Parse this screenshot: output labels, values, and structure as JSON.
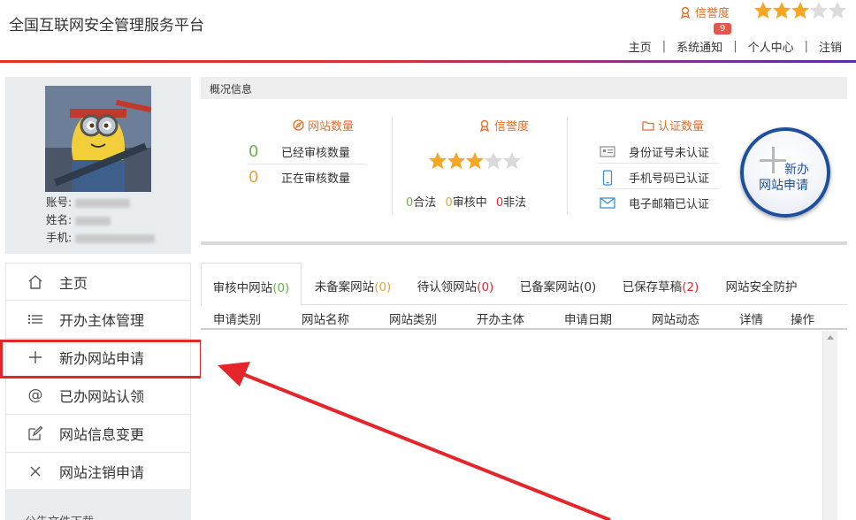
{
  "header": {
    "title": "全国互联网安全管理服务平台",
    "credit_label": "信誉度",
    "credit_stars": 3,
    "credit_stars_max": 5,
    "nav": [
      "主页",
      "系统通知",
      "个人中心",
      "注销"
    ],
    "notify_count": "9"
  },
  "profile": {
    "account_label": "账号:",
    "name_label": "姓名:",
    "phone_label": "手机:"
  },
  "menu": {
    "items": [
      {
        "label": "主页",
        "icon": "home-icon"
      },
      {
        "label": "开办主体管理",
        "icon": "list-icon"
      },
      {
        "label": "新办网站申请",
        "icon": "plus-icon"
      },
      {
        "label": "已办网站认领",
        "icon": "at-icon"
      },
      {
        "label": "网站信息变更",
        "icon": "edit-icon"
      },
      {
        "label": "网站注销申请",
        "icon": "close-icon"
      }
    ],
    "extra_label": "公告文件下载"
  },
  "overview": {
    "title": "概况信息",
    "site_count_title": "网站数量",
    "reviewed_num": "0",
    "reviewed_label": "已经审核数量",
    "reviewing_num": "0",
    "reviewing_label": "正在审核数量",
    "credit_title": "信誉度",
    "credit_stars": 3,
    "legal_num": "0",
    "legal_label": "合法",
    "auditing_num": "0",
    "auditing_label": "审核中",
    "illegal_num": "0",
    "illegal_label": "非法",
    "cert_title": "认证数量",
    "cert_items": [
      {
        "label": "身份证号未认证",
        "icon": "id-card-icon"
      },
      {
        "label": "手机号码已认证",
        "icon": "phone-icon"
      },
      {
        "label": "电子邮箱已认证",
        "icon": "mail-icon"
      }
    ],
    "new_site_line1": "新办",
    "new_site_line2": "网站申请"
  },
  "tabs": [
    {
      "label": "审核中网站",
      "count": "(0)"
    },
    {
      "label": "未备案网站",
      "count": "(0)"
    },
    {
      "label": "待认领网站",
      "count": "(0)"
    },
    {
      "label": "已备案网站",
      "count": "(0)"
    },
    {
      "label": "已保存草稿",
      "count": "(2)"
    },
    {
      "label": "网站安全防护",
      "count": ""
    }
  ],
  "table": {
    "columns": [
      "申请类别",
      "网站名称",
      "网站类别",
      "开办主体",
      "申请日期",
      "网站动态",
      "详情",
      "操作"
    ]
  },
  "colors": {
    "accent_orange": "#e36f2a",
    "highlight_red": "#e4262b",
    "star_gold": "#f5a623",
    "brand_blue": "#1e4f9c"
  }
}
